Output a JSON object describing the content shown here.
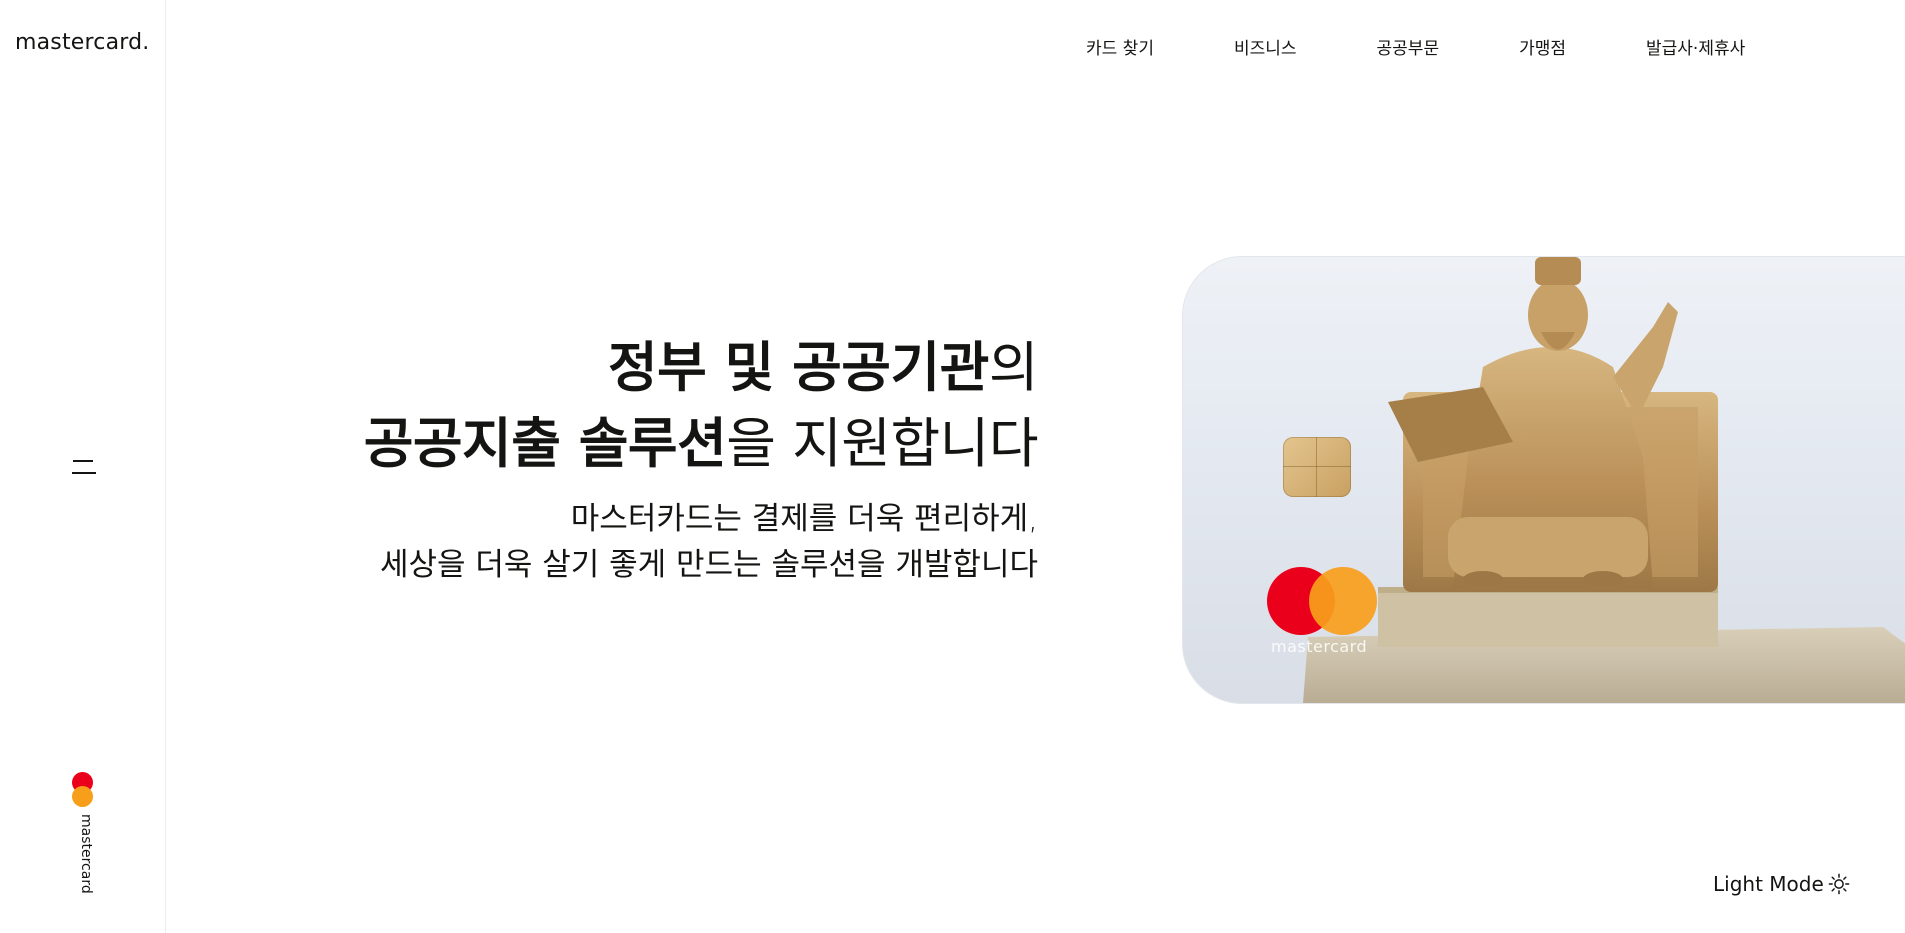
{
  "brand": {
    "logo_text": "mastercard.",
    "rail_text": "mastercard",
    "red": "#eb001b",
    "yellow": "#f79e1b"
  },
  "nav": {
    "items": [
      {
        "label": "카드 찾기"
      },
      {
        "label": "비즈니스"
      },
      {
        "label": "공공부문"
      },
      {
        "label": "가맹점"
      },
      {
        "label": "발급사·제휴사"
      }
    ]
  },
  "hero": {
    "line1_bold": "정부 및 공공기관",
    "line1_regular": "의",
    "line2_bold": "공공지출 솔루션",
    "line2_regular": "을 지원합니다",
    "sub1": "마스터카드는 결제를 더욱 편리하게,",
    "sub2": "세상을 더욱 살기 좋게 만드는 솔루션을 개발합니다"
  },
  "card": {
    "label": "mastercard"
  },
  "footer": {
    "light_mode_label": "Light Mode"
  },
  "icons": {
    "menu": "hamburger-icon",
    "theme": "sun-icon"
  }
}
